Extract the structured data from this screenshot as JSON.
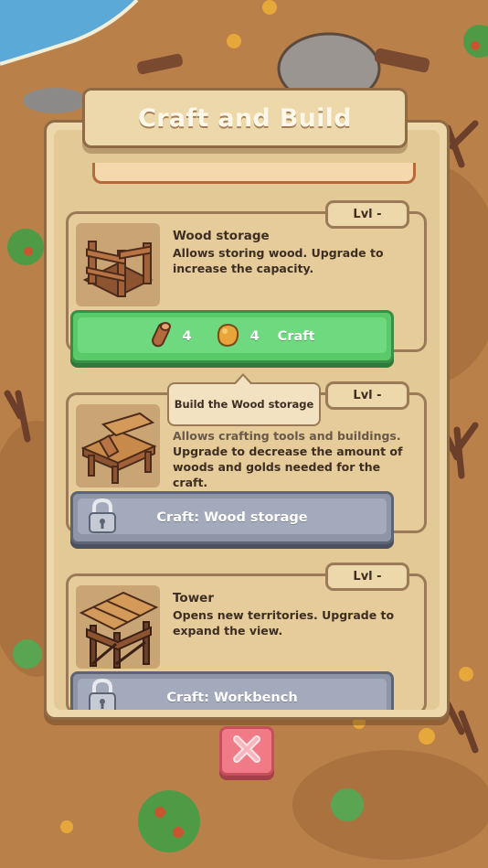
{
  "dialog": {
    "title": "Craft and Build"
  },
  "cards": [
    {
      "level": "Lvl -",
      "title": "Wood storage",
      "description": "Allows storing wood. Upgrade to increase the capacity.",
      "button": {
        "wood_cost": "4",
        "gold_cost": "4",
        "label": "Craft",
        "state": "available"
      }
    },
    {
      "level": "Lvl -",
      "description_hidden": "Allows crafting tools and buildings.",
      "description_visible": "Upgrade to decrease the amount of woods and golds needed for the craft.",
      "button": {
        "label": "Craft: Wood storage",
        "state": "locked"
      }
    },
    {
      "level": "Lvl -",
      "title": "Tower",
      "description": "Opens new territories. Upgrade to expand the view.",
      "button": {
        "label": "Craft: Workbench",
        "state": "locked"
      }
    }
  ],
  "tooltip": {
    "text": "Build the Wood storage"
  },
  "icons": {
    "wood": "wood-log-icon",
    "gold": "gold-nugget-icon",
    "lock": "lock-icon",
    "close": "close-x-icon"
  },
  "colors": {
    "craft_green": "#59c96a",
    "locked_gray": "#8e95a6",
    "close_red": "#f07b86",
    "panel_tan": "#ecd8aa"
  }
}
